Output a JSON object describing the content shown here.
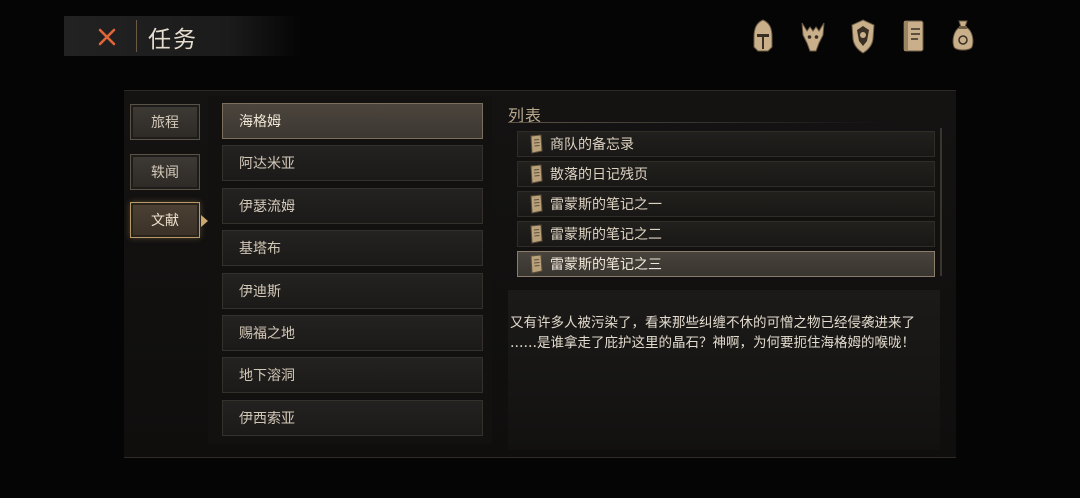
{
  "header": {
    "title": "任务",
    "close_icon": "close-x-icon",
    "top_icons": [
      "knight-helmet-icon",
      "horned-beast-icon",
      "crest-shield-icon",
      "journal-book-icon",
      "coin-pouch-icon"
    ]
  },
  "categories": [
    {
      "label": "旅程",
      "active": false
    },
    {
      "label": "轶闻",
      "active": false
    },
    {
      "label": "文献",
      "active": true
    }
  ],
  "regions": [
    {
      "label": "海格姆",
      "selected": true
    },
    {
      "label": "阿达米亚",
      "selected": false
    },
    {
      "label": "伊瑟流姆",
      "selected": false
    },
    {
      "label": "基塔布",
      "selected": false
    },
    {
      "label": "伊迪斯",
      "selected": false
    },
    {
      "label": "赐福之地",
      "selected": false
    },
    {
      "label": "地下溶洞",
      "selected": false
    },
    {
      "label": "伊西索亚",
      "selected": false
    }
  ],
  "list": {
    "header": "列表",
    "items": [
      {
        "label": "商队的备忘录",
        "selected": false
      },
      {
        "label": "散落的日记残页",
        "selected": false
      },
      {
        "label": "雷蒙斯的笔记之一",
        "selected": false
      },
      {
        "label": "雷蒙斯的笔记之二",
        "selected": false
      },
      {
        "label": "雷蒙斯的笔记之三",
        "selected": true
      }
    ]
  },
  "description": {
    "line1": "又有许多人被污染了，看来那些纠缠不休的可憎之物已经侵袭进来了",
    "line2": "……是谁拿走了庇护这里的晶石？神啊，为何要扼住海格姆的喉咙！"
  },
  "colors": {
    "accent": "#c9a870",
    "close_x": "#e0663a",
    "icon_gold": "#c9b08a"
  }
}
